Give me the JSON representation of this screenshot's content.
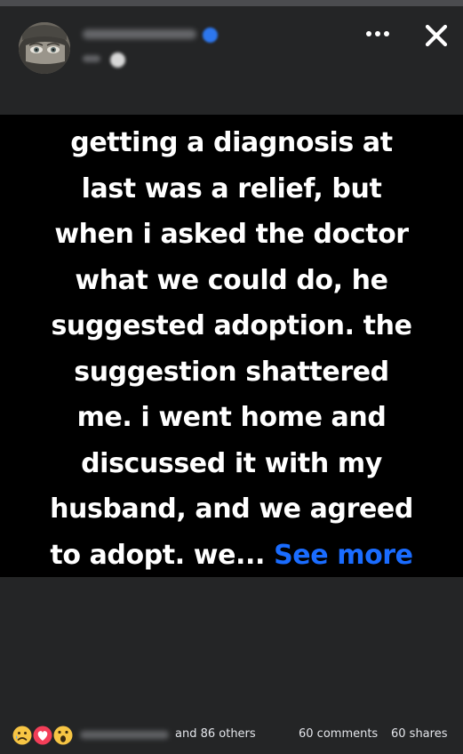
{
  "post": {
    "text_lines": [
      "getting a diagnosis at",
      "last was a relief, but",
      "when i asked the doctor",
      "what we could do, he",
      "suggested adoption. the",
      "suggestion shattered",
      "me. i went home and",
      "discussed it with my",
      "husband, and we agreed",
      "to adopt. we... "
    ],
    "see_more_label": "See more",
    "background_color": "#000000",
    "text_color": "#ffffff",
    "link_color": "#1a6cff"
  },
  "header": {
    "icons": [
      "avatar",
      "verified-badge-icon",
      "globe-icon",
      "more-options-icon",
      "close-icon"
    ],
    "accent_color": "#2d77ee"
  },
  "footer": {
    "reaction_icons": [
      "sad-reaction-icon",
      "love-reaction-icon",
      "wow-reaction-icon"
    ],
    "others_text": "and 86 others",
    "comments_text": "60 comments",
    "shares_text": "60 shares"
  }
}
